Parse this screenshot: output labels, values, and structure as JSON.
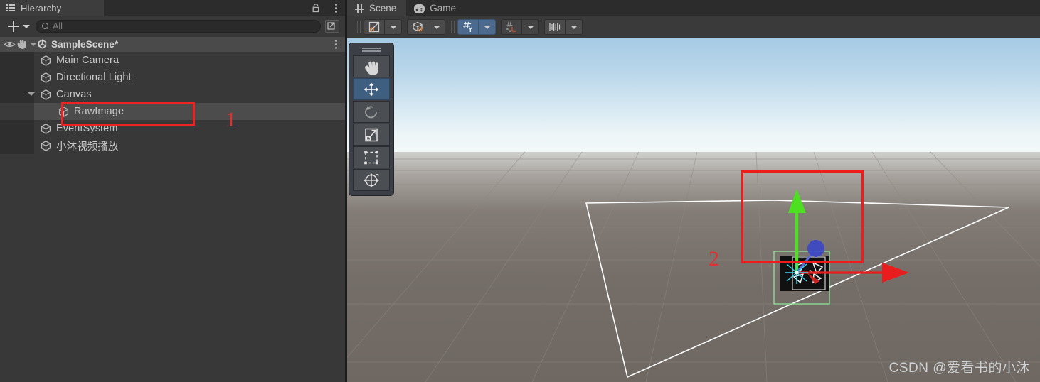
{
  "hierarchy": {
    "tab_label": "Hierarchy",
    "tab_icon": "hierarchy-list-icon",
    "lock_icon": "lock-icon",
    "menu_icon": "kebab-menu-icon",
    "add_button_label": "+",
    "add_dropdown_icon": "chevron-down-icon",
    "search": {
      "placeholder": "All",
      "icon": "search-icon",
      "value": ""
    },
    "expand_button_icon": "expand-panel-icon",
    "scene_row": {
      "name": "SampleScene*",
      "visibility_icon": "eye-icon",
      "pickability_icon": "hand-icon",
      "expand_icon": "triangle-down-icon",
      "scene_icon": "unity-scene-icon",
      "menu_icon": "kebab-menu-icon"
    },
    "items": [
      {
        "label": "Main Camera",
        "icon": "cube-icon",
        "depth": 1,
        "expandable": false,
        "selected": false
      },
      {
        "label": "Directional Light",
        "icon": "cube-icon",
        "depth": 1,
        "expandable": false,
        "selected": false
      },
      {
        "label": "Canvas",
        "icon": "cube-icon",
        "depth": 1,
        "expandable": true,
        "selected": false
      },
      {
        "label": "RawImage",
        "icon": "cube-icon",
        "depth": 2,
        "expandable": false,
        "selected": true
      },
      {
        "label": "EventSystem",
        "icon": "cube-icon",
        "depth": 1,
        "expandable": false,
        "selected": false
      },
      {
        "label": "小沐视频播放",
        "icon": "cube-icon",
        "depth": 1,
        "expandable": false,
        "selected": false
      }
    ]
  },
  "scene_panel": {
    "tabs": [
      {
        "label": "Scene",
        "icon": "grid-icon",
        "active": true
      },
      {
        "label": "Game",
        "icon": "gamepad-icon",
        "active": false
      }
    ],
    "toolbar": [
      {
        "name": "draw-mode-dropdown",
        "icon": "shaded-draw-mode-icon",
        "state": "normal",
        "has_dropdown": true
      },
      {
        "name": "scene-2d-dropdown",
        "icon": "scene-cube-icon",
        "state": "normal",
        "has_dropdown": true
      },
      {
        "name": "grid-snap-toggle",
        "icon": "grid-axis-y-icon",
        "state": "active",
        "has_dropdown": true
      },
      {
        "name": "magnet-snap-toggle",
        "icon": "magnet-snap-icon",
        "state": "disabled",
        "has_dropdown": true
      },
      {
        "name": "gizmo-scale-slider",
        "icon": "scale-slider-icon",
        "state": "normal",
        "has_dropdown": true
      }
    ],
    "tool_palette": [
      {
        "name": "hand-tool",
        "icon": "hand-icon",
        "selected": false,
        "disabled": false
      },
      {
        "name": "move-tool",
        "icon": "move-arrows-icon",
        "selected": true,
        "disabled": false
      },
      {
        "name": "rotate-tool",
        "icon": "rotate-icon",
        "selected": false,
        "disabled": true
      },
      {
        "name": "scale-tool",
        "icon": "scale-icon",
        "selected": false,
        "disabled": false
      },
      {
        "name": "rect-tool",
        "icon": "rect-transform-icon",
        "selected": false,
        "disabled": false
      },
      {
        "name": "transform-tool",
        "icon": "transform-icon",
        "selected": false,
        "disabled": false
      }
    ],
    "gizmo": {
      "x_axis_color": "#e81d1d",
      "y_axis_color": "#4ce020",
      "z_axis_color": "#3a45c8",
      "selection_outline_color": "#8fe39a"
    },
    "colors": {
      "sky_top": "#a6cbe5",
      "horizon": "#f4f8f8",
      "ground": "#756e68",
      "accent_blue": "#4b6a8e",
      "annotation_red": "#f01c1c"
    }
  },
  "annotations": [
    {
      "label": "1",
      "target": "RawImage hierarchy entry"
    },
    {
      "label": "2",
      "target": "RawImage object in scene view"
    }
  ],
  "watermark": "CSDN @爱看书的小沐"
}
